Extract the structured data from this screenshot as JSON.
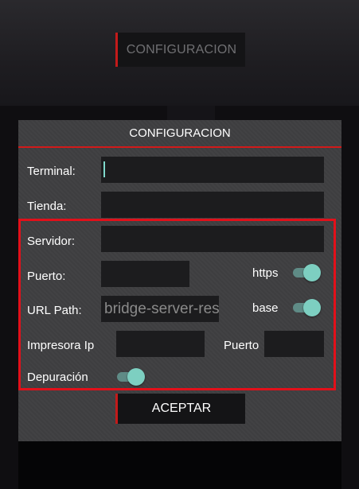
{
  "background": {
    "top_button_label": "CONFIGURACION"
  },
  "dialog": {
    "title": "CONFIGURACION",
    "fields": {
      "terminal": {
        "label": "Terminal:",
        "value": ""
      },
      "tienda": {
        "label": "Tienda:",
        "value": ""
      },
      "servidor": {
        "label": "Servidor:",
        "value": ""
      },
      "puerto": {
        "label": "Puerto:",
        "value": ""
      },
      "url_path": {
        "label": "URL Path:",
        "placeholder": "bridge-server-res"
      },
      "impresora_ip": {
        "label": "Impresora Ip",
        "value": ""
      },
      "impresora_puerto": {
        "label": "Puerto",
        "value": ""
      }
    },
    "toggles": {
      "https": {
        "label": "https",
        "on": true
      },
      "base": {
        "label": "base",
        "on": true
      },
      "depuracion": {
        "label": "Depuración",
        "on": true
      }
    },
    "accept_label": "ACEPTAR"
  },
  "colors": {
    "accent_red": "#d21a1a",
    "toggle_on": "#7dcfc1",
    "dialog_bg": "#3f3f41"
  }
}
